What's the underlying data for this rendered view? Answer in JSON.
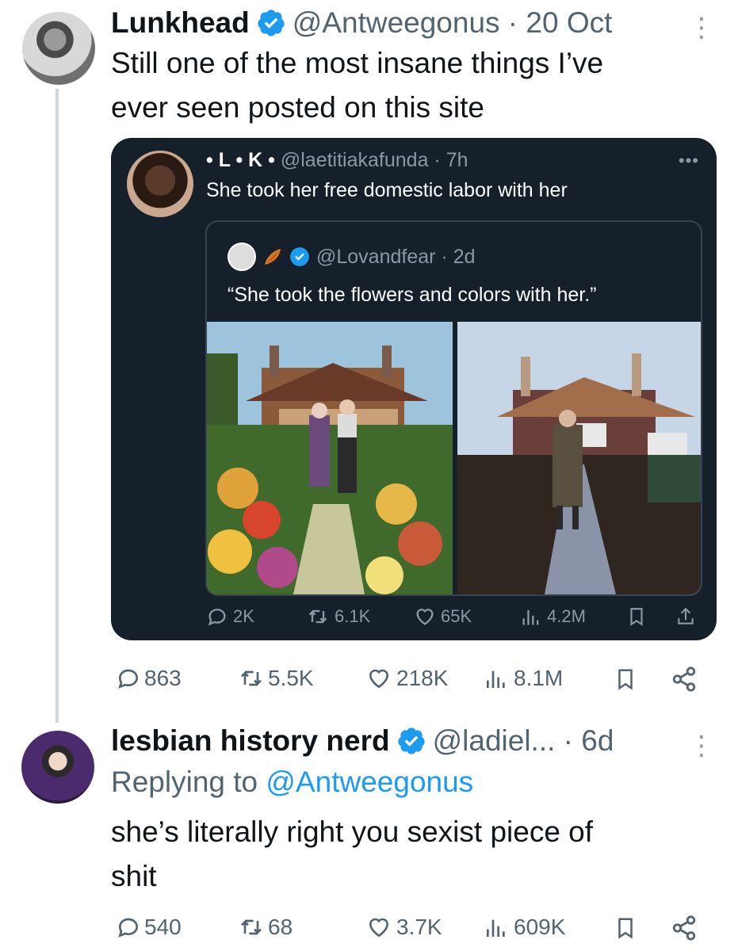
{
  "tweet1": {
    "name": "Lunkhead",
    "handle": "@Antweegonus · 20 Oct",
    "text_line1": "Still one of the most insane things I’ve",
    "text_line2": "ever seen posted on this site",
    "more": "⋮",
    "stats": {
      "replies": "863",
      "retweets": "5.5K",
      "likes": "218K",
      "views": "8.1M"
    }
  },
  "quoted": {
    "name": "• L • K •",
    "handle": "@laetitiakafunda · 7h",
    "text": "She took her free domestic labor with her",
    "more": "•••",
    "stats": {
      "replies": "2K",
      "retweets": "6.1K",
      "likes": "65K",
      "views": "4.2M"
    },
    "inner": {
      "handle": "@Lovandfear · 2d",
      "text": "“She took the flowers and colors with her.”"
    }
  },
  "tweet2": {
    "name": "lesbian history nerd",
    "handle": "@ladiel... · 6d",
    "replying_prefix": "Replying to ",
    "replying_to": "@Antweegonus",
    "text_line1": "she’s literally right you sexist piece of",
    "text_line2": "shit",
    "more": "⋮",
    "stats": {
      "replies": "540",
      "retweets": "68",
      "likes": "3.7K",
      "views": "609K"
    }
  },
  "colors": {
    "verified": "#1d9bf0",
    "link": "#1d9bf0",
    "muted": "#536471",
    "card_bg": "#15202b"
  }
}
